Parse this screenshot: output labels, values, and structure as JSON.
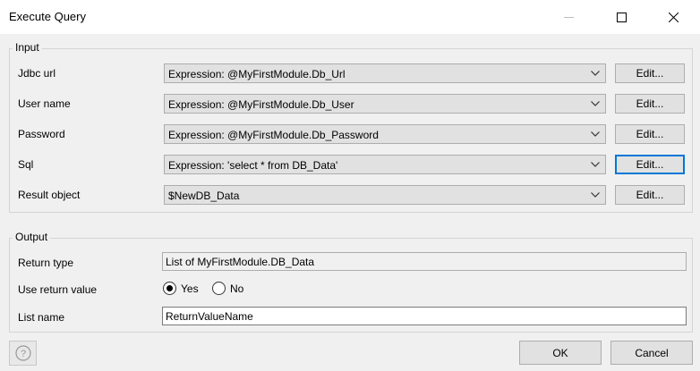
{
  "window": {
    "title": "Execute Query"
  },
  "input": {
    "group_label": "Input",
    "rows": [
      {
        "label": "Jdbc url",
        "value": "Expression: @MyFirstModule.Db_Url",
        "button": "Edit..."
      },
      {
        "label": "User name",
        "value": "Expression: @MyFirstModule.Db_User",
        "button": "Edit..."
      },
      {
        "label": "Password",
        "value": "Expression: @MyFirstModule.Db_Password",
        "button": "Edit..."
      },
      {
        "label": "Sql",
        "value": "Expression: 'select * from DB_Data'",
        "button": "Edit..."
      },
      {
        "label": "Result object",
        "value": "$NewDB_Data",
        "button": "Edit..."
      }
    ]
  },
  "output": {
    "group_label": "Output",
    "return_type_label": "Return type",
    "return_type_value": "List of MyFirstModule.DB_Data",
    "use_return_label": "Use return value",
    "yes_label": "Yes",
    "no_label": "No",
    "use_return_selected": "Yes",
    "list_name_label": "List name",
    "list_name_value": "ReturnValueName"
  },
  "footer": {
    "ok": "OK",
    "cancel": "Cancel"
  },
  "icons": {
    "minimize": "minimize-icon",
    "maximize": "maximize-icon",
    "close": "close-icon",
    "dropdown": "chevron-down-icon",
    "help": "question-icon"
  },
  "colors": {
    "focus_border": "#0078d7",
    "dialog_bg": "#f0f0f0",
    "titlebar_bg": "#ffffff"
  }
}
